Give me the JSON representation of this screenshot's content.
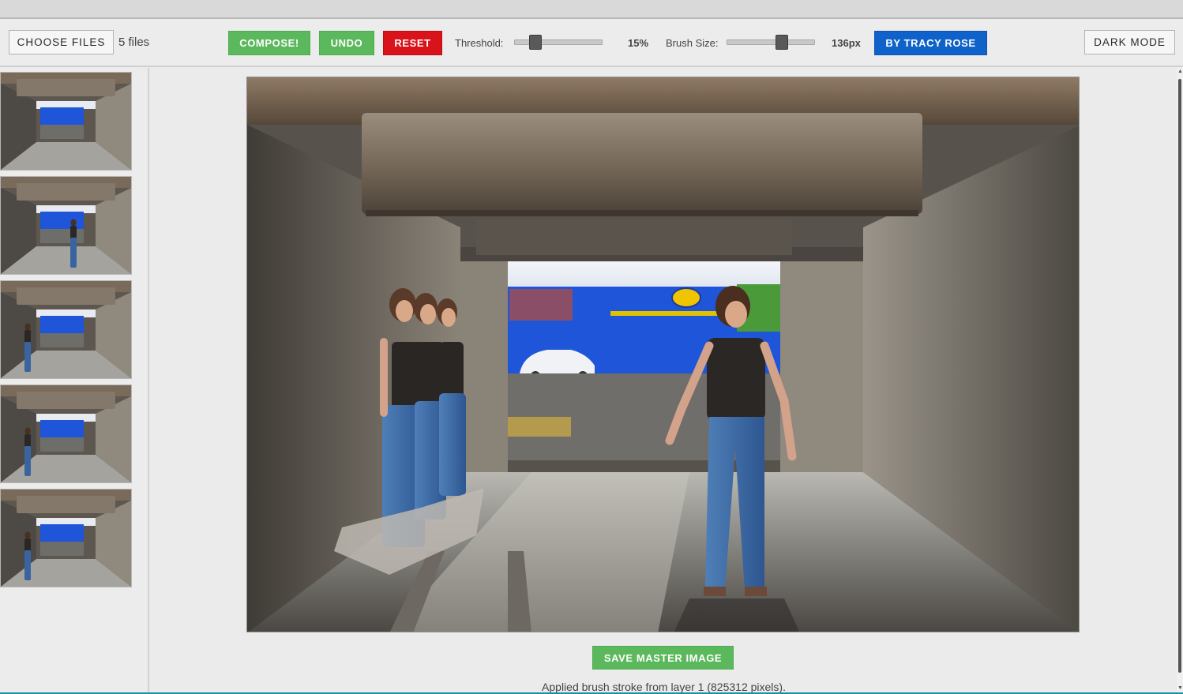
{
  "toolbar": {
    "choose_files_label": "CHOOSE FILES",
    "file_count": "5 files",
    "compose_label": "COMPOSE!",
    "undo_label": "UNDO",
    "reset_label": "RESET",
    "threshold_label": "Threshold:",
    "threshold_value": "15%",
    "threshold_fraction": 0.2,
    "brush_size_label": "Brush Size:",
    "brush_size_value": "136px",
    "brush_size_fraction": 0.65,
    "credit_label": "BY TRACY ROSE",
    "dark_mode_label": "DARK MODE"
  },
  "colors": {
    "green": "#5cb85c",
    "red": "#d9131a",
    "blue": "#0f62c9"
  },
  "sidebar": {
    "thumbnails": [
      {
        "person": "none"
      },
      {
        "person": "center-right"
      },
      {
        "person": "left"
      },
      {
        "person": "left"
      },
      {
        "person": "left"
      }
    ]
  },
  "main": {
    "image_description_icon": "composite-image",
    "save_label": "SAVE MASTER IMAGE",
    "status": "Applied brush stroke from layer 1 (825312 pixels)."
  }
}
